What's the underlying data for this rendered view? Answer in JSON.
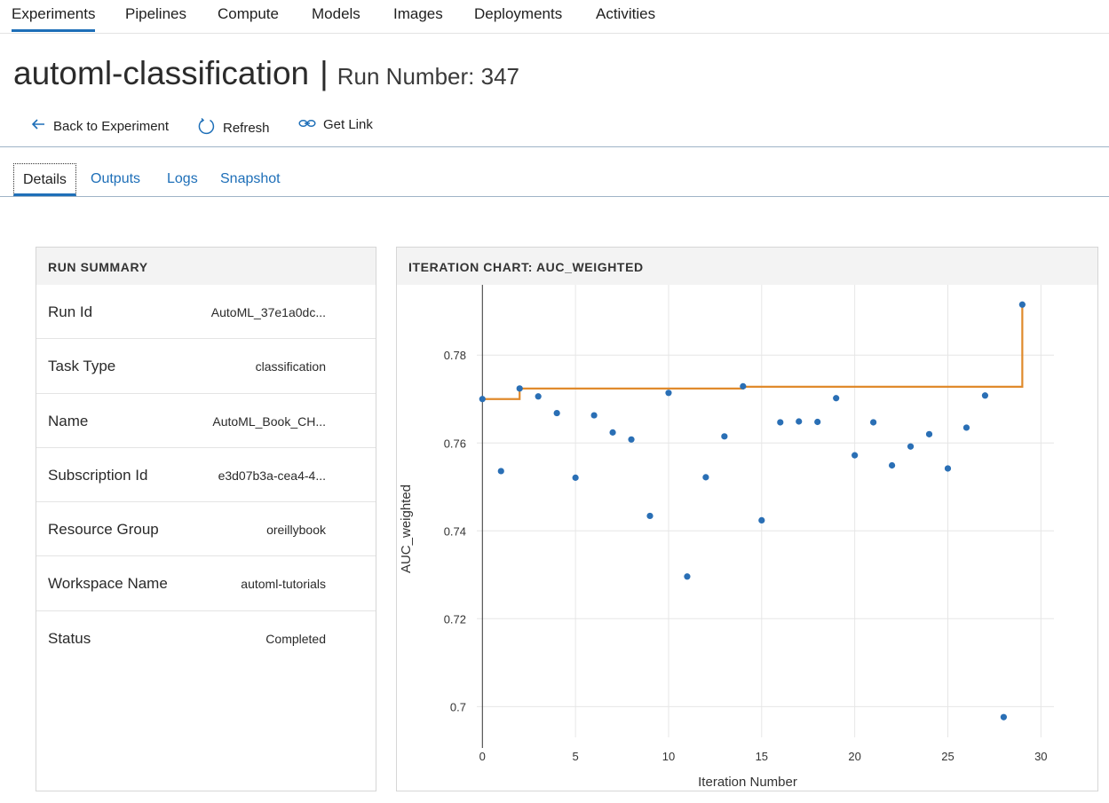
{
  "nav": {
    "items": [
      "Experiments",
      "Pipelines",
      "Compute",
      "Models",
      "Images",
      "Deployments",
      "Activities"
    ],
    "active": "Experiments"
  },
  "title": {
    "name": "automl-classification",
    "separator": "|",
    "run_label": "Run Number: 347"
  },
  "toolbar": {
    "back_label": "Back to Experiment",
    "refresh_label": "Refresh",
    "link_label": "Get Link"
  },
  "tabs": [
    "Details",
    "Outputs",
    "Logs",
    "Snapshot"
  ],
  "summary": {
    "header": "RUN SUMMARY",
    "rows": [
      {
        "label": "Run Id",
        "value": "AutoML_37e1a0dc..."
      },
      {
        "label": "Task Type",
        "value": "classification"
      },
      {
        "label": "Name",
        "value": "AutoML_Book_CH..."
      },
      {
        "label": "Subscription Id",
        "value": "e3d07b3a-cea4-4..."
      },
      {
        "label": "Resource Group",
        "value": "oreillybook"
      },
      {
        "label": "Workspace Name",
        "value": "automl-tutorials"
      },
      {
        "label": "Status",
        "value": "Completed"
      }
    ]
  },
  "colors": {
    "accent": "#1e6fb8",
    "points": "#2a6fb5",
    "best_line": "#e08a2c"
  },
  "chart_data": {
    "type": "scatter",
    "title": "ITERATION CHART: AUC_WEIGHTED",
    "xlabel": "Iteration Number",
    "ylabel": "AUC_weighted",
    "xlim": [
      -0.3,
      30.7
    ],
    "ylim": [
      0.693,
      0.796
    ],
    "xticks": [
      0,
      5,
      10,
      15,
      20,
      25,
      30
    ],
    "yticks": [
      0.7,
      0.72,
      0.74,
      0.76,
      0.78
    ],
    "ytick_labels": [
      "0.7",
      "0.72",
      "0.74",
      "0.76",
      "0.78"
    ],
    "grid": true,
    "x": [
      0,
      1,
      2,
      3,
      4,
      5,
      6,
      7,
      8,
      9,
      10,
      11,
      12,
      13,
      14,
      15,
      16,
      17,
      18,
      19,
      20,
      21,
      22,
      23,
      24,
      25,
      26,
      27,
      28,
      29
    ],
    "y": [
      0.77,
      0.7536,
      0.7724,
      0.7706,
      0.7668,
      0.7521,
      0.7663,
      0.7624,
      0.7608,
      0.7434,
      0.7714,
      0.7296,
      0.7522,
      0.7615,
      0.7729,
      0.7424,
      0.7647,
      0.7649,
      0.7648,
      0.7702,
      0.7572,
      0.7647,
      0.7549,
      0.7592,
      0.762,
      0.7542,
      0.7635,
      0.7708,
      0.6976,
      0.7915
    ],
    "best_step": [
      [
        0,
        0.77
      ],
      [
        2,
        0.77
      ],
      [
        2,
        0.7724
      ],
      [
        14,
        0.7724
      ],
      [
        14,
        0.7728
      ],
      [
        29,
        0.7728
      ],
      [
        29,
        0.7915
      ]
    ]
  }
}
